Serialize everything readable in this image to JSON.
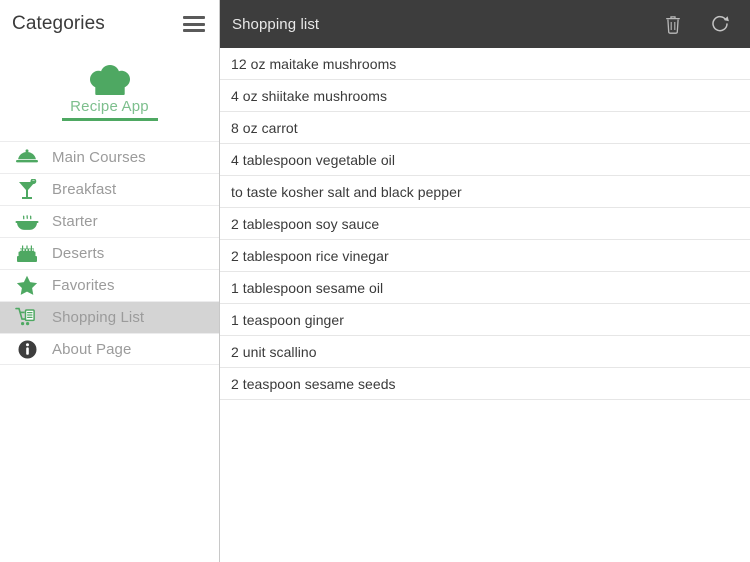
{
  "sidebar": {
    "title": "Categories",
    "menu_icon": "hamburger-menu-icon",
    "brand": {
      "logo_icon": "chef-hat-icon",
      "name": "Recipe App"
    },
    "items": [
      {
        "label": "Main Courses",
        "icon": "cloche-food-cover-icon",
        "active": false
      },
      {
        "label": "Breakfast",
        "icon": "cocktail-glass-icon",
        "active": false
      },
      {
        "label": "Starter",
        "icon": "steaming-bowl-icon",
        "active": false
      },
      {
        "label": "Deserts",
        "icon": "layer-cake-icon",
        "active": false
      },
      {
        "label": "Favorites",
        "icon": "star-icon",
        "active": false
      },
      {
        "label": "Shopping List",
        "icon": "shopping-cart-icon",
        "active": true
      },
      {
        "label": "About Page",
        "icon": "info-circle-icon",
        "active": false
      }
    ]
  },
  "topbar": {
    "title": "Shopping list",
    "delete_icon": "trash-icon",
    "refresh_icon": "refresh-icon"
  },
  "shopping_list": {
    "items": [
      "12 oz maitake mushrooms",
      "4 oz shiitake mushrooms",
      "8 oz carrot",
      "4 tablespoon vegetable oil",
      "to taste kosher salt and black pepper",
      "2 tablespoon soy sauce",
      "2 tablespoon rice vinegar",
      "1 tablespoon sesame oil",
      "1 teaspoon ginger",
      "2 unit scallino",
      "2 teaspoon sesame seeds"
    ]
  },
  "colors": {
    "green": "#4ea862",
    "green_light": "#7dbf8d",
    "header_dark": "#3d3d3d",
    "active_row": "#d4d4d4",
    "label_gray": "#9b9b9b"
  }
}
